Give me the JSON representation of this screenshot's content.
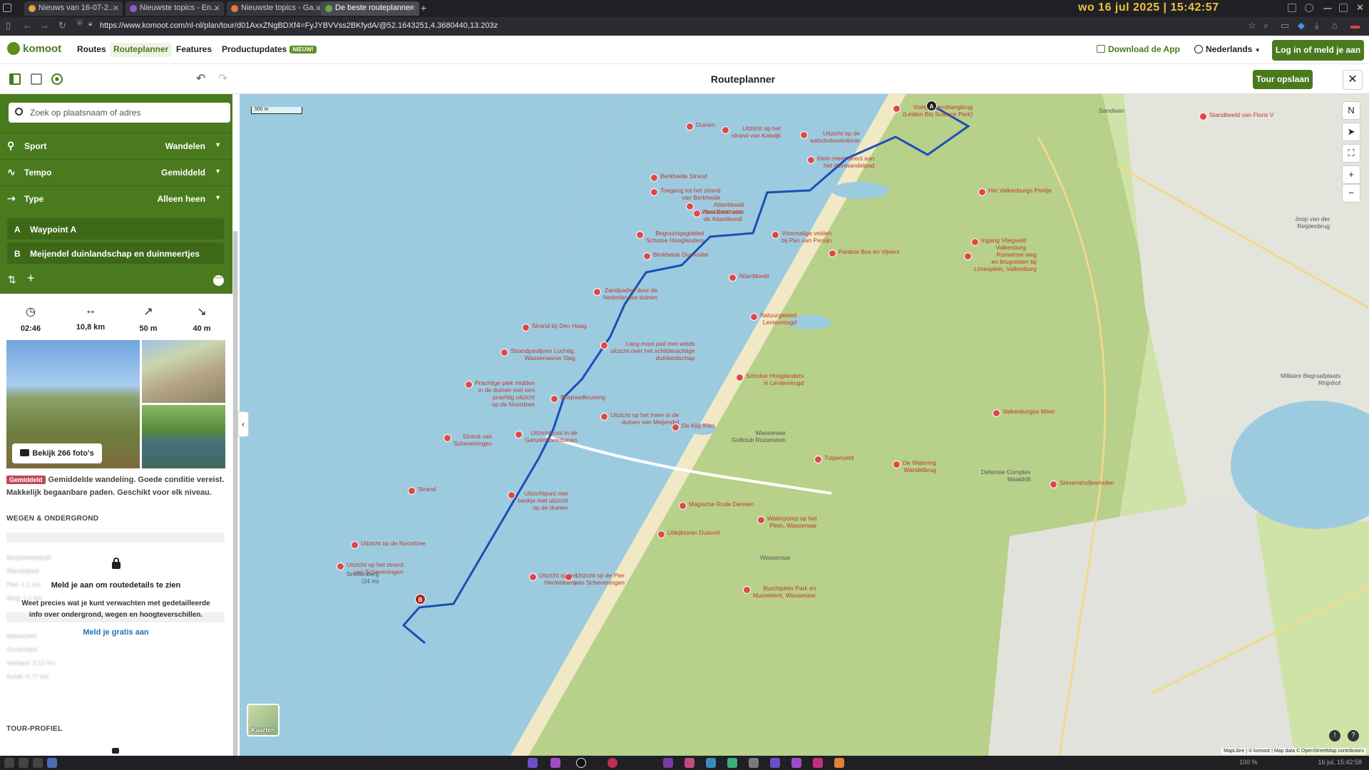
{
  "browser": {
    "tabs": [
      {
        "label": "Nieuws van 16-07-2...",
        "color": "#e8a33b"
      },
      {
        "label": "Nieuwste topics - En...",
        "color": "#8a5cc7"
      },
      {
        "label": "Nieuwste topics - Ga...",
        "color": "#e8783b"
      },
      {
        "label": "De beste routeplanner",
        "color": "#6aa84f"
      }
    ],
    "new_tab": "+",
    "clock": "wo 16 jul 2025 | 15:42:57",
    "url": "https://www.komoot.com/nl-nl/plan/tour/d01AxxZNgBDXf4=FyJYBVVss2BKfydA/@52.1643251,4.3680440,13.203z"
  },
  "header": {
    "logo": "komoot",
    "nav": [
      "Routes",
      "Routeplanner",
      "Features",
      "Productupdates"
    ],
    "new_badge": "NIEUW!",
    "download": "Download de App",
    "language": "Nederlands",
    "login": "Log in of meld je aan"
  },
  "toolbar": {
    "title": "Routeplanner",
    "save": "Tour opslaan"
  },
  "sidebar": {
    "search_placeholder": "Zoek op plaatsnaam of adres",
    "settings": [
      {
        "label": "Sport",
        "value": "Wandelen",
        "icon": "⚲"
      },
      {
        "label": "Tempo",
        "value": "Gemiddeld",
        "icon": "∿"
      },
      {
        "label": "Type",
        "value": "Alleen heen",
        "icon": "⇢"
      }
    ],
    "waypoints": [
      {
        "letter": "A",
        "name": "Waypoint A"
      },
      {
        "letter": "B",
        "name": "Meijendel duinlandschap en duinmeertjes"
      }
    ],
    "stats": [
      {
        "icon": "◷",
        "value": "02:46"
      },
      {
        "icon": "↔",
        "value": "10,8 km"
      },
      {
        "icon": "↗",
        "value": "50 m"
      },
      {
        "icon": "↘",
        "value": "40 m"
      }
    ],
    "see_photos": "Bekijk 266 foto's",
    "difficulty_tag": "Gemiddeld",
    "difficulty_text": "Gemiddelde wandeling. Goede conditie vereist. Makkelijk begaanbare paden. Geschikt voor elk niveau.",
    "roads_heading": "WEGEN & ONDERGROND",
    "blurred_rows": [
      "Bergwandelpad",
      "Wandelpad",
      "Pad: 1,1 km",
      "Weg: 1,0 km",
      "Natuurpad",
      "Onverhard",
      "Verhard: 3,12 km",
      "Asfalt: 6,77 km"
    ],
    "lock_title": "Meld je aan om routedetails te zien",
    "lock_text": "Weet precies wat je kunt verwachten met gedetailleerde info over ondergrond, wegen en hoogteverschillen.",
    "lock_link": "Meld je gratis aan",
    "profile_heading": "TOUR-PROFIEL"
  },
  "map": {
    "scale": "500 m",
    "layers_button": "Kaarten",
    "attribution": "MapLibre | © komoot | Map data © OpenStreetMap contributors",
    "north": "N",
    "zoom_in": "+",
    "zoom_out": "−",
    "labels": [
      {
        "text": "Voetgangershangbrug\n(Leiden Bio Science Park)",
        "pin": true
      },
      {
        "text": "Sandlaan",
        "pin": false
      },
      {
        "text": "Standbeeld van Floris V",
        "pin": true
      },
      {
        "text": "Duinen",
        "pin": true
      },
      {
        "text": "Uitzicht op het\nstrand van Katwijk",
        "pin": true
      },
      {
        "text": "Uitzicht op de\naalscholverkolonie",
        "pin": true
      },
      {
        "text": "Klein meer direct aan\nhet duinwandelpad",
        "pin": true
      },
      {
        "text": "Berkheide Strand",
        "pin": true
      },
      {
        "text": "Toegang tot het strand\nvan Berkheide",
        "pin": true
      },
      {
        "text": "Atlantikwall\nBunker Berkheide",
        "pin": true
      },
      {
        "text": "Restanten van\nde Atlantikwall",
        "pin": true
      },
      {
        "text": "Het Valkenburgs Pontje",
        "pin": true
      },
      {
        "text": "Joop van der\nReijdenbrug",
        "pin": false
      },
      {
        "text": "Begrazingsgebied\nSchotse Hooglanders",
        "pin": true
      },
      {
        "text": "Voormalige velden\nbij Pan van Persijn",
        "pin": true
      },
      {
        "text": "Ingang Vliegveld\nValkenburg",
        "pin": true
      },
      {
        "text": "Berkheide Duinvallei",
        "pin": true
      },
      {
        "text": "Panbos Bos en Vijvers",
        "pin": true
      },
      {
        "text": "Romeinse weg\nen brugresten bij\nLimesplein, Valkenburg",
        "pin": true
      },
      {
        "text": "Atlantikwall",
        "pin": true
      },
      {
        "text": "Zandpaden door de\nNederlandse duinen",
        "pin": true
      },
      {
        "text": "Natuurgebied\nLentevreugd",
        "pin": true
      },
      {
        "text": "Strand bij Den Haag",
        "pin": true
      },
      {
        "text": "Strandpaviljoen Luchtig,\nWassenaarse Slag",
        "pin": true
      },
      {
        "text": "Lang mooi pad met weids\nuitzicht over het schilderachtige\nduinlandschap",
        "pin": true
      },
      {
        "text": "Schotse Hooglanders\nin Lentevreugd",
        "pin": true
      },
      {
        "text": "Militaire Begraafplaats\nRhijnhof",
        "pin": false
      },
      {
        "text": "Prachtige plek midden\nin de duinen met een\nprachtig uitzicht\nop de Noordzee",
        "pin": true
      },
      {
        "text": "Bospaadkruising",
        "pin": true
      },
      {
        "text": "Uitzicht op het meer in de\nduinen van Meijendel",
        "pin": true
      },
      {
        "text": "Valkenburgse Meer",
        "pin": true
      },
      {
        "text": "De Klip Klim",
        "pin": true
      },
      {
        "text": "Strand van\nScheveningen",
        "pin": true
      },
      {
        "text": "Uitzichtpunt in de\nGanzenhoekduinen",
        "pin": true
      },
      {
        "text": "Wassenaar\nGolfclub Rozenstein",
        "pin": false
      },
      {
        "text": "Tulpenveld",
        "pin": true
      },
      {
        "text": "De Watering\nWandelbrug",
        "pin": true
      },
      {
        "text": "Defensie Complex\nMaaldrift",
        "pin": false
      },
      {
        "text": "Stevenshofjesmolen",
        "pin": true
      },
      {
        "text": "Strand",
        "pin": true
      },
      {
        "text": "Uitzichtpunt met\nbankje met uitzicht\nop de duinen",
        "pin": true
      },
      {
        "text": "Magische Rode Dennen",
        "pin": true
      },
      {
        "text": "Waterpomp op het\nPlein, Wassenaar",
        "pin": true
      },
      {
        "text": "Uitzicht op de Noordzee",
        "pin": true
      },
      {
        "text": "Uitkijktoren Duinrell",
        "pin": true
      },
      {
        "text": "Wassenaar",
        "pin": false
      },
      {
        "text": "Uitzicht op de Pier\nvan Scheveningen",
        "pin": true
      },
      {
        "text": "Uitzicht op het strand\nvan Scheveningen",
        "pin": true
      },
      {
        "text": "Snellenberg\n(24 m)",
        "pin": false
      },
      {
        "text": "Uitzicht op het\nHertenkamp",
        "pin": true
      },
      {
        "text": "Burchtplein Park en\nMuziektent, Wassenaar",
        "pin": true
      }
    ]
  },
  "taskbar": {
    "zoom": "100 %",
    "time": "16 jul, 15:42:58"
  },
  "colors": {
    "brand": "#4a7a1e",
    "sea": "#9ccbe0",
    "dune": "#b7d08a",
    "route": "#1a4fb5",
    "poi": "#e04848"
  }
}
